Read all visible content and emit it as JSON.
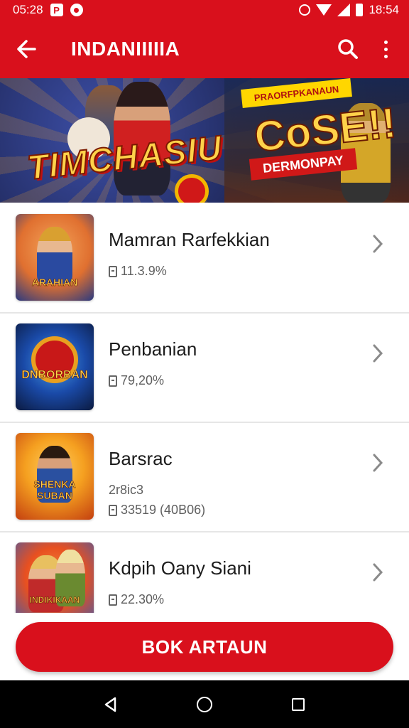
{
  "status_bar": {
    "left_time": "05:28",
    "app_icon_letter": "P",
    "right_time": "18:54"
  },
  "app_bar": {
    "title": "INDANIIIIIA",
    "icons": {
      "back": "arrow-left-icon",
      "search": "search-icon",
      "more": "more-vert-icon"
    }
  },
  "banner": {
    "logo_text": "TIMCHASIU",
    "promo_tag": "PRAORFPKANAUN",
    "cta_text": "CoSE!!",
    "ribbon_text": "DERMONPAY"
  },
  "list": {
    "items": [
      {
        "title": "Mamran Rarfekkian",
        "meta": "11.3.9%",
        "thumb_label": "ARAHIAN",
        "thumb_colors": [
          "#e8823a",
          "#2a4aa0"
        ]
      },
      {
        "title": "Penbanian",
        "meta": "79,20%",
        "thumb_label": "DNBORBAN",
        "thumb_colors": [
          "#1a4aa8",
          "#0b1a40"
        ]
      },
      {
        "title": "Barsrac",
        "sub": "2r8ic3",
        "meta": "33519 (40B06)",
        "thumb_label": "SHENKA SUBAN",
        "thumb_colors": [
          "#f5a020",
          "#c44010"
        ]
      },
      {
        "title": "Kdpih Oany Siani",
        "meta": "22.30%",
        "thumb_label": "INDIKIKAAN",
        "thumb_colors": [
          "#e85020",
          "#3a5ab0"
        ]
      }
    ]
  },
  "action_button": {
    "label": "BOK ARTAUN"
  },
  "colors": {
    "brand_red": "#d9101c",
    "text_dark": "#1c1c1c",
    "text_muted": "#5f5f5f"
  }
}
